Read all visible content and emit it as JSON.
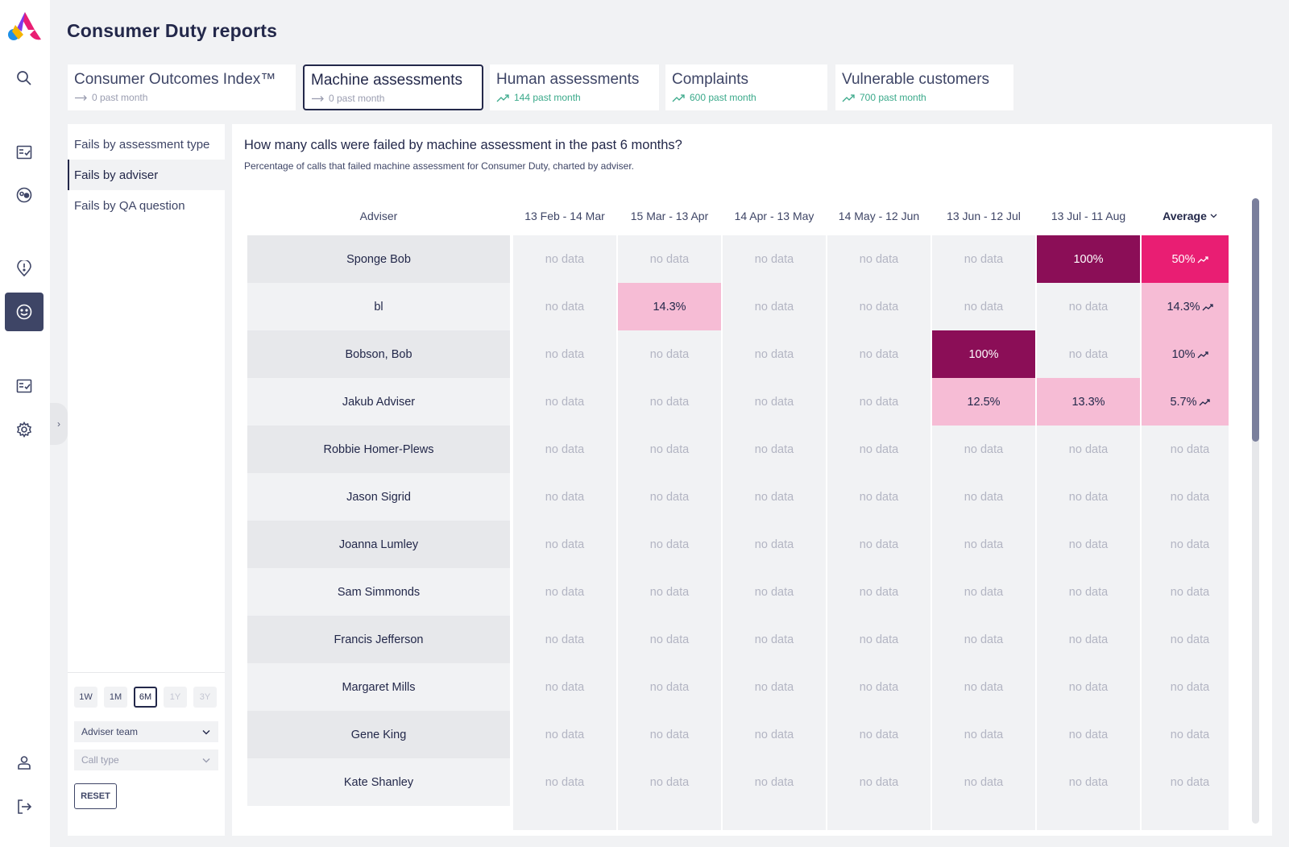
{
  "header": {
    "title": "Consumer Duty reports"
  },
  "tabs": [
    {
      "label": "Consumer Outcomes Index™",
      "sub": "0 past month",
      "trend": "flat"
    },
    {
      "label": "Machine assessments",
      "sub": "0 past month",
      "trend": "flat"
    },
    {
      "label": "Human assessments",
      "sub": "144 past month",
      "trend": "up"
    },
    {
      "label": "Complaints",
      "sub": "600 past month",
      "trend": "up"
    },
    {
      "label": "Vulnerable customers",
      "sub": "700 past month",
      "trend": "up"
    }
  ],
  "subnav": {
    "items": [
      {
        "label": "Fails by assessment type"
      },
      {
        "label": "Fails by adviser"
      },
      {
        "label": "Fails by QA question"
      }
    ],
    "periods": [
      "1W",
      "1M",
      "6M",
      "1Y",
      "3Y"
    ],
    "selected_period": "6M",
    "filters": {
      "adviser_team": "Adviser team",
      "call_type": "Call type"
    },
    "reset_label": "RESET"
  },
  "main": {
    "question": "How many calls were failed by machine assessment in the past 6 months?",
    "subtitle": "Percentage of calls that failed machine assessment for Consumer Duty, charted by adviser."
  },
  "colors": {
    "light": "#f6bcd5",
    "mid": "#e91e73",
    "dark": "#8b0e57",
    "rail_active": "#3e4566"
  },
  "chart_data": {
    "type": "heatmap",
    "columns": [
      "Adviser",
      "13 Feb - 14 Mar",
      "15 Mar - 13 Apr",
      "14 Apr - 13 May",
      "14 May - 12 Jun",
      "13 Jun - 12 Jul",
      "13 Jul - 11 Aug",
      "Average"
    ],
    "rows": [
      {
        "adviser": "Sponge Bob",
        "values": [
          "no data",
          "no data",
          "no data",
          "no data",
          "no data",
          "100%"
        ],
        "levels": [
          "",
          "",
          "",
          "",
          "",
          "dark"
        ],
        "average": "50%",
        "avg_level": "mid",
        "avg_trend": true
      },
      {
        "adviser": "bl",
        "values": [
          "no data",
          "14.3%",
          "no data",
          "no data",
          "no data",
          "no data"
        ],
        "levels": [
          "",
          "light",
          "",
          "",
          "",
          ""
        ],
        "average": "14.3%",
        "avg_level": "light",
        "avg_trend": true
      },
      {
        "adviser": "Bobson, Bob",
        "values": [
          "no data",
          "no data",
          "no data",
          "no data",
          "100%",
          "no data"
        ],
        "levels": [
          "",
          "",
          "",
          "",
          "dark",
          ""
        ],
        "average": "10%",
        "avg_level": "light",
        "avg_trend": true
      },
      {
        "adviser": "Jakub Adviser",
        "values": [
          "no data",
          "no data",
          "no data",
          "no data",
          "12.5%",
          "13.3%"
        ],
        "levels": [
          "",
          "",
          "",
          "",
          "light",
          "light"
        ],
        "average": "5.7%",
        "avg_level": "light",
        "avg_trend": true
      },
      {
        "adviser": "Robbie Homer-Plews",
        "values": [
          "no data",
          "no data",
          "no data",
          "no data",
          "no data",
          "no data"
        ],
        "levels": [
          "",
          "",
          "",
          "",
          "",
          ""
        ],
        "average": "no data",
        "avg_level": "",
        "avg_trend": false
      },
      {
        "adviser": "Jason Sigrid",
        "values": [
          "no data",
          "no data",
          "no data",
          "no data",
          "no data",
          "no data"
        ],
        "levels": [
          "",
          "",
          "",
          "",
          "",
          ""
        ],
        "average": "no data",
        "avg_level": "",
        "avg_trend": false
      },
      {
        "adviser": "Joanna Lumley",
        "values": [
          "no data",
          "no data",
          "no data",
          "no data",
          "no data",
          "no data"
        ],
        "levels": [
          "",
          "",
          "",
          "",
          "",
          ""
        ],
        "average": "no data",
        "avg_level": "",
        "avg_trend": false
      },
      {
        "adviser": "Sam Simmonds",
        "values": [
          "no data",
          "no data",
          "no data",
          "no data",
          "no data",
          "no data"
        ],
        "levels": [
          "",
          "",
          "",
          "",
          "",
          ""
        ],
        "average": "no data",
        "avg_level": "",
        "avg_trend": false
      },
      {
        "adviser": "Francis Jefferson",
        "values": [
          "no data",
          "no data",
          "no data",
          "no data",
          "no data",
          "no data"
        ],
        "levels": [
          "",
          "",
          "",
          "",
          "",
          ""
        ],
        "average": "no data",
        "avg_level": "",
        "avg_trend": false
      },
      {
        "adviser": "Margaret Mills",
        "values": [
          "no data",
          "no data",
          "no data",
          "no data",
          "no data",
          "no data"
        ],
        "levels": [
          "",
          "",
          "",
          "",
          "",
          ""
        ],
        "average": "no data",
        "avg_level": "",
        "avg_trend": false
      },
      {
        "adviser": "Gene King",
        "values": [
          "no data",
          "no data",
          "no data",
          "no data",
          "no data",
          "no data"
        ],
        "levels": [
          "",
          "",
          "",
          "",
          "",
          ""
        ],
        "average": "no data",
        "avg_level": "",
        "avg_trend": false
      },
      {
        "adviser": "Kate Shanley",
        "values": [
          "no data",
          "no data",
          "no data",
          "no data",
          "no data",
          "no data"
        ],
        "levels": [
          "",
          "",
          "",
          "",
          "",
          ""
        ],
        "average": "no data",
        "avg_level": "",
        "avg_trend": false
      }
    ]
  }
}
